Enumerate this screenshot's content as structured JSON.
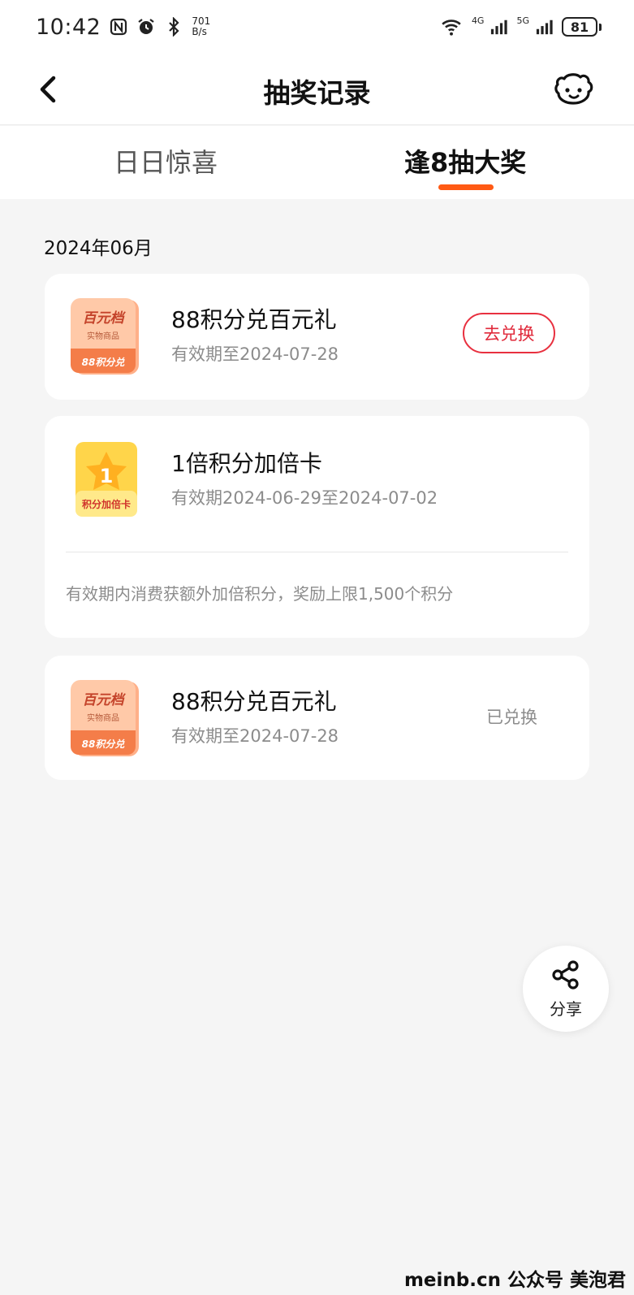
{
  "status_bar": {
    "time": "10:42",
    "net_speed_value": "701",
    "net_speed_unit": "B/s",
    "signal_1": "4G",
    "signal_2": "5G",
    "battery": "81",
    "icons": [
      "nfc-icon",
      "alarm-icon",
      "bluetooth-icon",
      "wifi-icon",
      "signal-icon",
      "battery-icon"
    ]
  },
  "nav": {
    "title": "抽奖记录",
    "back_icon": "chevron-left-icon",
    "service_icon": "customer-service-icon"
  },
  "tabs": [
    {
      "label": "日日惊喜",
      "active": false
    },
    {
      "label": "逢8抽大奖",
      "active": true
    }
  ],
  "month_header": "2024年06月",
  "records": [
    {
      "name": "88积分兑百元礼",
      "validity": "有效期至2024-07-28",
      "action_label": "去兑换",
      "icon": {
        "title": "百元档",
        "subtitle": "实物商品",
        "footer": "88积分兑"
      }
    },
    {
      "name": "1倍积分加倍卡",
      "validity": "有效期2024-06-29至2024-07-02",
      "description": "有效期内消费获额外加倍积分，奖励上限1,500个积分",
      "icon": {
        "number": "1",
        "footer": "积分加倍卡"
      }
    },
    {
      "name": "88积分兑百元礼",
      "validity": "有效期至2024-07-28",
      "status_label": "已兑换",
      "icon": {
        "title": "百元档",
        "subtitle": "实物商品",
        "footer": "88积分兑"
      }
    }
  ],
  "share": {
    "label": "分享",
    "icon": "share-icon"
  },
  "watermark": "meinb.cn  公众号 美泡君",
  "colors": {
    "accent": "#ff5a14",
    "redeem": "#e0293a",
    "background": "#f5f5f5"
  }
}
